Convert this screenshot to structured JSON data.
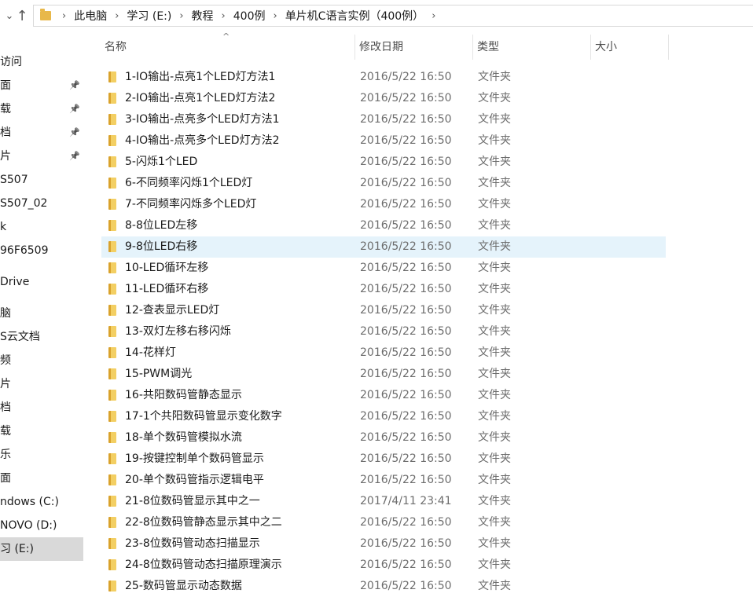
{
  "address": {
    "breadcrumbs": [
      "此电脑",
      "学习 (E:)",
      "教程",
      "400例",
      "单片机C语言实例（400例）"
    ]
  },
  "nav": {
    "items": [
      {
        "label": "访问",
        "pinned": false
      },
      {
        "label": "面",
        "pinned": true
      },
      {
        "label": "载",
        "pinned": true
      },
      {
        "label": "档",
        "pinned": true
      },
      {
        "label": "片",
        "pinned": true
      },
      {
        "label": "S507",
        "pinned": false
      },
      {
        "label": "S507_02",
        "pinned": false
      },
      {
        "label": "k",
        "pinned": false
      },
      {
        "label": "96F6509",
        "pinned": false
      },
      {
        "label": "Drive",
        "pinned": false
      },
      {
        "label": "脑",
        "pinned": false
      },
      {
        "label": "S云文档",
        "pinned": false
      },
      {
        "label": "频",
        "pinned": false
      },
      {
        "label": "片",
        "pinned": false
      },
      {
        "label": "档",
        "pinned": false
      },
      {
        "label": "载",
        "pinned": false
      },
      {
        "label": "乐",
        "pinned": false
      },
      {
        "label": "面",
        "pinned": false
      },
      {
        "label": "ndows (C:)",
        "pinned": false
      },
      {
        "label": "NOVO (D:)",
        "pinned": false
      },
      {
        "label": "习 (E:)",
        "pinned": false,
        "selected": true
      }
    ]
  },
  "columns": {
    "name": "名称",
    "date": "修改日期",
    "type": "类型",
    "size": "大小"
  },
  "files": [
    {
      "name": "1-IO输出-点亮1个LED灯方法1",
      "date": "2016/5/22 16:50",
      "type": "文件夹"
    },
    {
      "name": "2-IO输出-点亮1个LED灯方法2",
      "date": "2016/5/22 16:50",
      "type": "文件夹"
    },
    {
      "name": "3-IO输出-点亮多个LED灯方法1",
      "date": "2016/5/22 16:50",
      "type": "文件夹"
    },
    {
      "name": "4-IO输出-点亮多个LED灯方法2",
      "date": "2016/5/22 16:50",
      "type": "文件夹"
    },
    {
      "name": "5-闪烁1个LED",
      "date": "2016/5/22 16:50",
      "type": "文件夹"
    },
    {
      "name": "6-不同频率闪烁1个LED灯",
      "date": "2016/5/22 16:50",
      "type": "文件夹"
    },
    {
      "name": "7-不同频率闪烁多个LED灯",
      "date": "2016/5/22 16:50",
      "type": "文件夹"
    },
    {
      "name": "8-8位LED左移",
      "date": "2016/5/22 16:50",
      "type": "文件夹"
    },
    {
      "name": "9-8位LED右移",
      "date": "2016/5/22 16:50",
      "type": "文件夹",
      "hover": true
    },
    {
      "name": "10-LED循环左移",
      "date": "2016/5/22 16:50",
      "type": "文件夹"
    },
    {
      "name": "11-LED循环右移",
      "date": "2016/5/22 16:50",
      "type": "文件夹"
    },
    {
      "name": "12-查表显示LED灯",
      "date": "2016/5/22 16:50",
      "type": "文件夹"
    },
    {
      "name": "13-双灯左移右移闪烁",
      "date": "2016/5/22 16:50",
      "type": "文件夹"
    },
    {
      "name": "14-花样灯",
      "date": "2016/5/22 16:50",
      "type": "文件夹"
    },
    {
      "name": "15-PWM调光",
      "date": "2016/5/22 16:50",
      "type": "文件夹"
    },
    {
      "name": "16-共阳数码管静态显示",
      "date": "2016/5/22 16:50",
      "type": "文件夹"
    },
    {
      "name": "17-1个共阳数码管显示变化数字",
      "date": "2016/5/22 16:50",
      "type": "文件夹"
    },
    {
      "name": "18-单个数码管模拟水流",
      "date": "2016/5/22 16:50",
      "type": "文件夹"
    },
    {
      "name": "19-按键控制单个数码管显示",
      "date": "2016/5/22 16:50",
      "type": "文件夹"
    },
    {
      "name": "20-单个数码管指示逻辑电平",
      "date": "2016/5/22 16:50",
      "type": "文件夹"
    },
    {
      "name": "21-8位数码管显示其中之一",
      "date": "2017/4/11 23:41",
      "type": "文件夹"
    },
    {
      "name": "22-8位数码管静态显示其中之二",
      "date": "2016/5/22 16:50",
      "type": "文件夹"
    },
    {
      "name": "23-8位数码管动态扫描显示",
      "date": "2016/5/22 16:50",
      "type": "文件夹"
    },
    {
      "name": "24-8位数码管动态扫描原理演示",
      "date": "2016/5/22 16:50",
      "type": "文件夹"
    },
    {
      "name": "25-数码管显示动态数据",
      "date": "2016/5/22 16:50",
      "type": "文件夹"
    }
  ]
}
